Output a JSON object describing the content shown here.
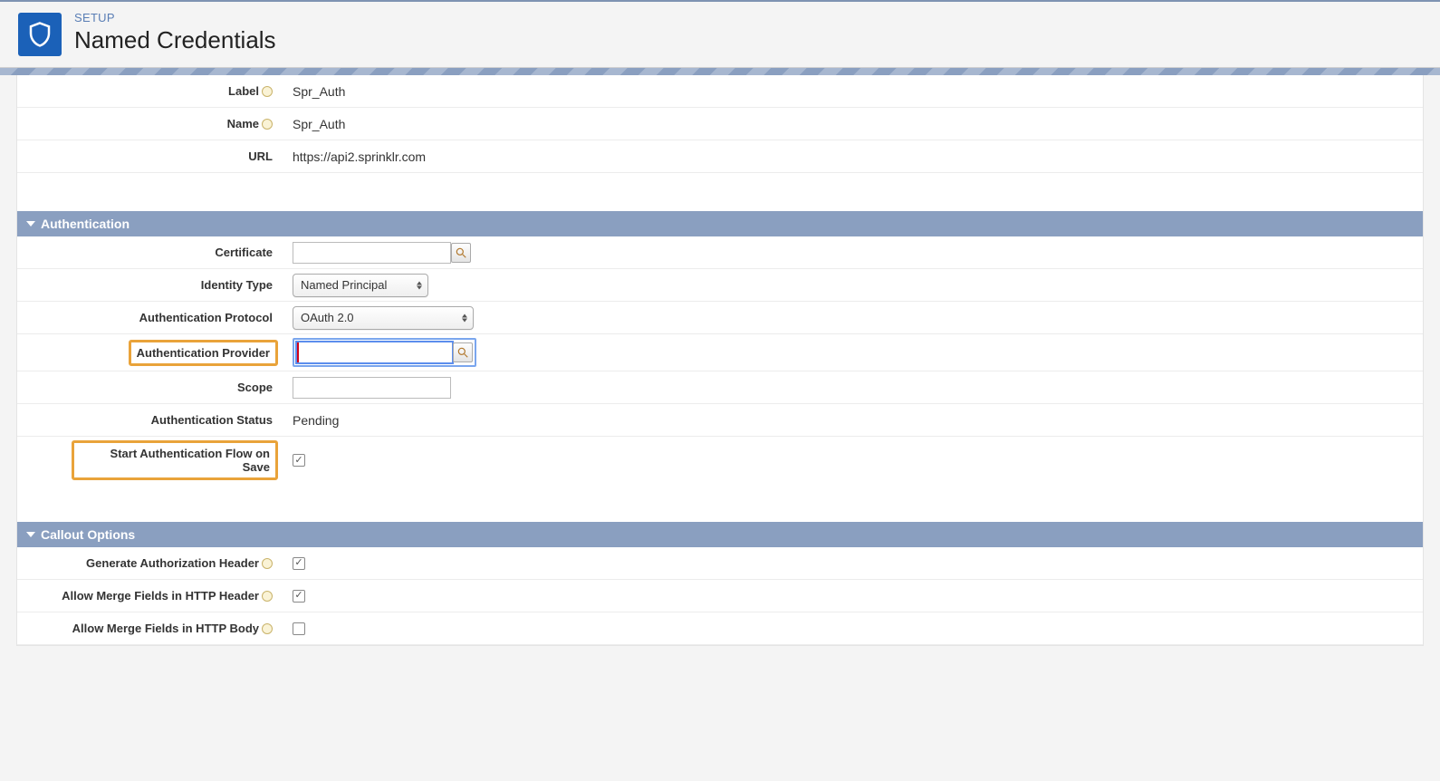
{
  "header": {
    "eyebrow": "SETUP",
    "title": "Named Credentials"
  },
  "basic": {
    "label_label": "Label",
    "label_value": "Spr_Auth",
    "name_label": "Name",
    "name_value": "Spr_Auth",
    "url_label": "URL",
    "url_value": "https://api2.sprinklr.com"
  },
  "sections": {
    "authentication": "Authentication",
    "callout": "Callout Options"
  },
  "auth": {
    "certificate_label": "Certificate",
    "certificate_value": "",
    "identity_type_label": "Identity Type",
    "identity_type_value": "Named Principal",
    "protocol_label": "Authentication Protocol",
    "protocol_value": "OAuth 2.0",
    "provider_label": "Authentication Provider",
    "provider_value": "",
    "scope_label": "Scope",
    "scope_value": "",
    "status_label": "Authentication Status",
    "status_value": "Pending",
    "start_flow_label": "Start Authentication Flow on Save",
    "start_flow_checked": true
  },
  "callout": {
    "gen_auth_header_label": "Generate Authorization Header",
    "gen_auth_header_checked": true,
    "merge_header_label": "Allow Merge Fields in HTTP Header",
    "merge_header_checked": true,
    "merge_body_label": "Allow Merge Fields in HTTP Body",
    "merge_body_checked": false
  }
}
